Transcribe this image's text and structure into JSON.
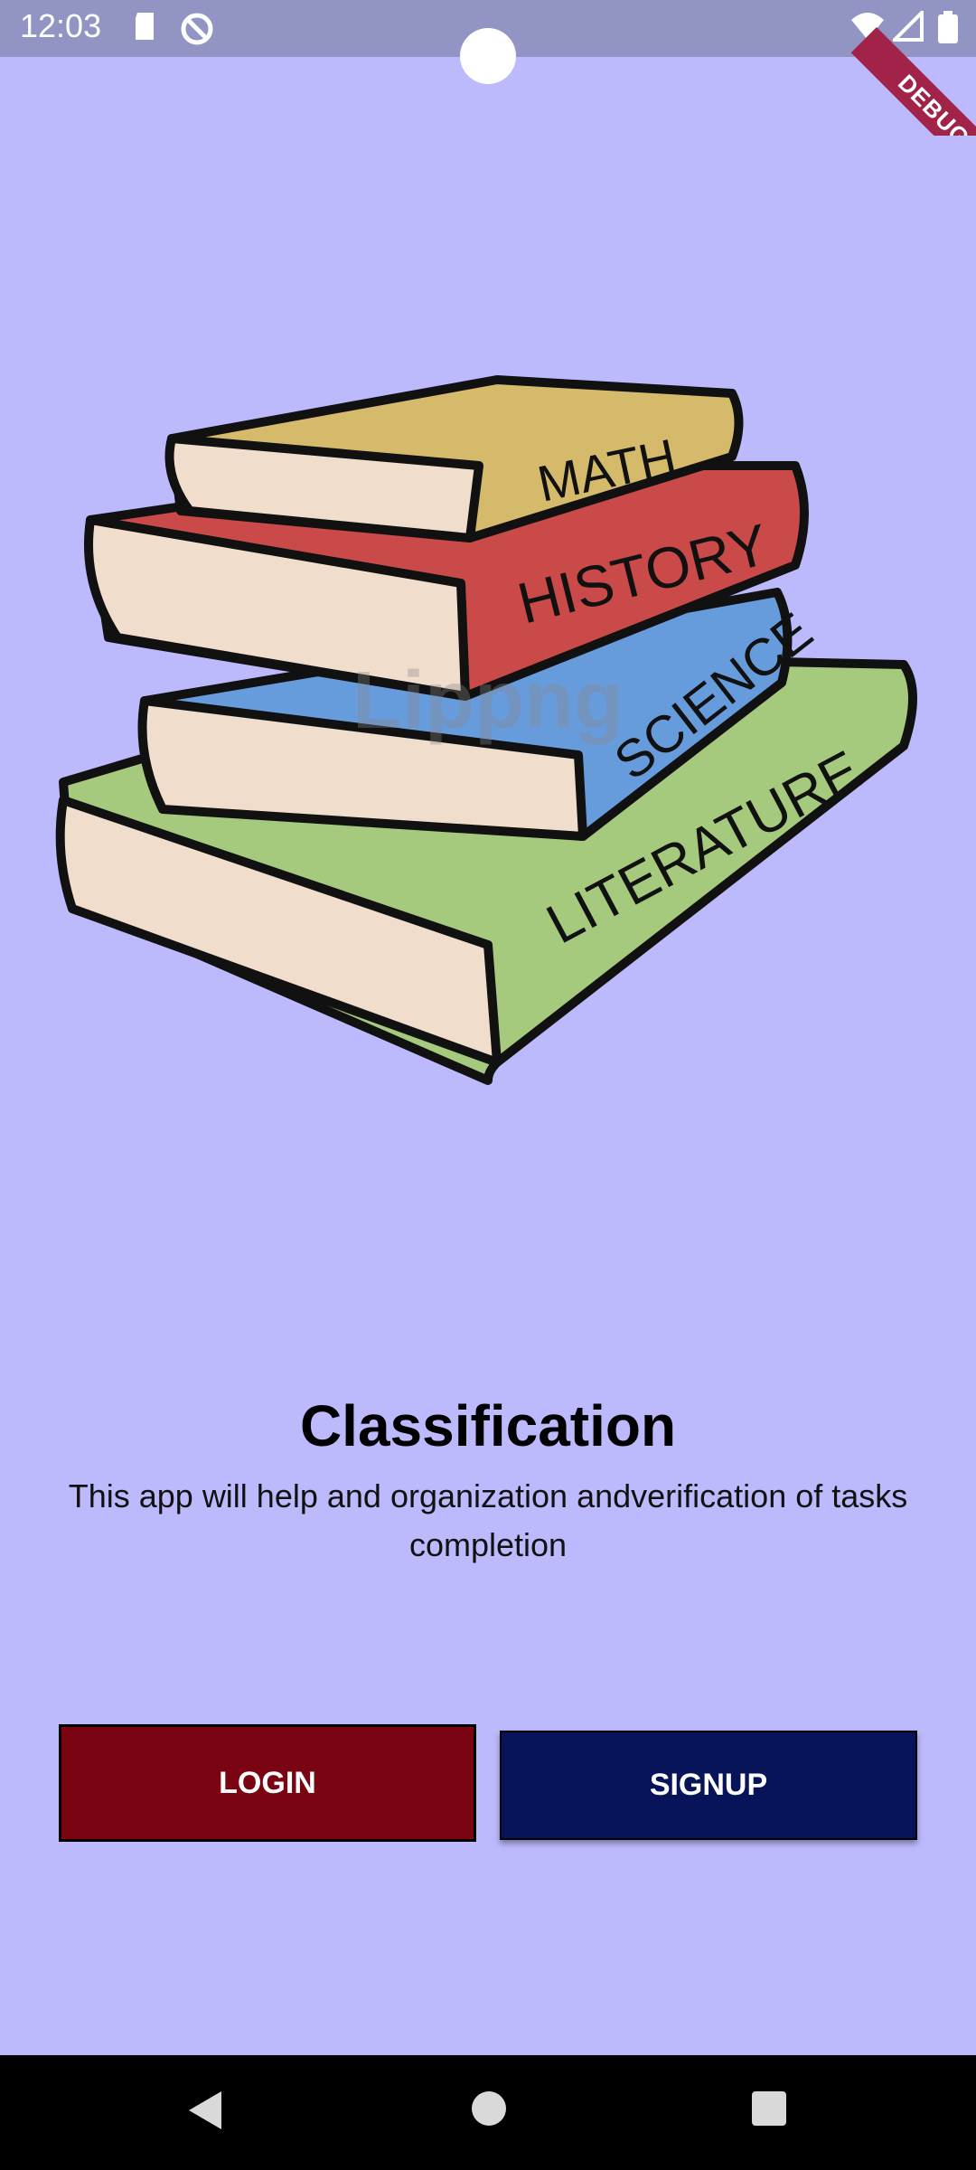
{
  "status_bar": {
    "time": "12:03",
    "icons": [
      "sd-card-icon",
      "no-sync-icon",
      "wifi-icon",
      "signal-icon",
      "battery-icon"
    ],
    "color": "#9294c4"
  },
  "debug_banner": {
    "label": "DEBUG",
    "color": "#a2234a"
  },
  "hero": {
    "books": [
      "MATH",
      "HISTORY",
      "SCIENCE",
      "LITERATURE"
    ],
    "watermark": "Lippng"
  },
  "main": {
    "title": "Classification",
    "subtitle": "This app will help and organization andverification of tasks completion"
  },
  "buttons": {
    "login_label": "LOGIN",
    "signup_label": "SIGNUP",
    "login_color": "#7a0412",
    "signup_color": "#071459"
  },
  "nav_bar": {
    "icons": [
      "back-icon",
      "home-icon",
      "recents-icon"
    ]
  },
  "colors": {
    "background": "#bdb9fd"
  }
}
